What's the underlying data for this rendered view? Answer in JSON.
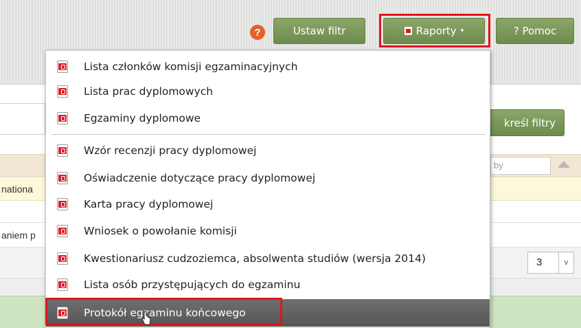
{
  "toolbar": {
    "help_symbol": "?",
    "filter_button": "Ustaw filtr",
    "reports_button": "Raporty",
    "reports_caret": "▾",
    "help_button": "? Pomoc"
  },
  "filters": {
    "clear_button": "kreśl filtry",
    "search_partial": "by"
  },
  "table": {
    "row_partial_1": "nationa",
    "row_partial_2": "aniem p",
    "page_size_value": "3",
    "page_size_arrow": "v"
  },
  "menu": {
    "items": [
      {
        "label": "Lista członków komisji egzaminacyjnych"
      },
      {
        "label": "Lista prac dyplomowych"
      },
      {
        "label": "Egzaminy dyplomowe"
      },
      {
        "label": "Wzór recenzji pracy dyplomowej"
      },
      {
        "label": "Oświadczenie dotyczące pracy dyplomowej"
      },
      {
        "label": "Karta pracy dyplomowej"
      },
      {
        "label": "Wniosek o powołanie komisji"
      },
      {
        "label": "Kwestionariusz cudzoziemca, absolwenta studiów (wersja 2014)"
      },
      {
        "label": "Lista osób przystępujących do egzaminu"
      },
      {
        "label": "Protokół egzaminu końcowego"
      }
    ]
  },
  "colors": {
    "accent_green": "#7a9758",
    "highlight_red": "#e0161b",
    "active_item": "#5f5f5f",
    "pdf_red": "#d8232a"
  }
}
